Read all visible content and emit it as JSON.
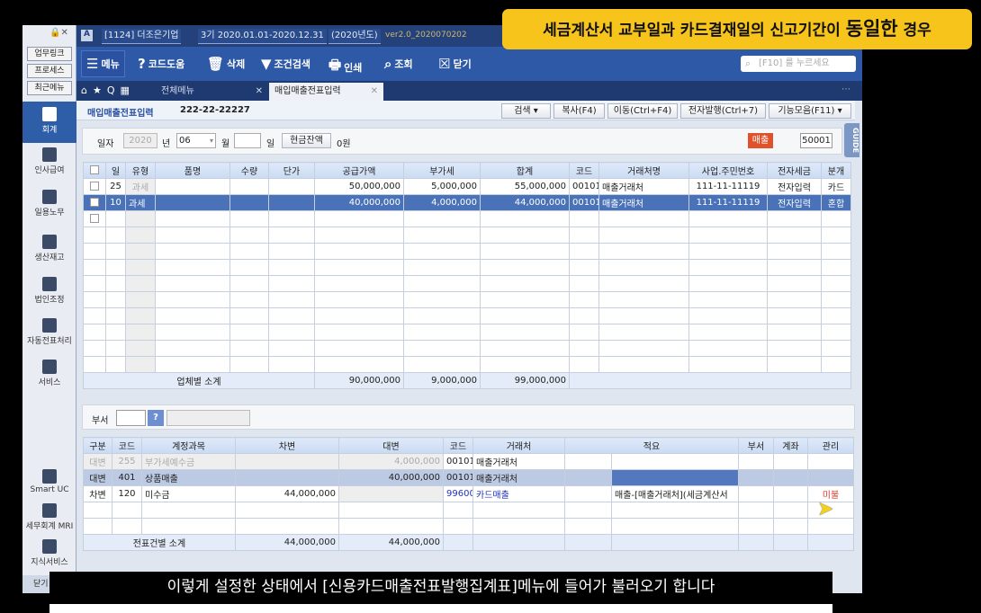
{
  "banner": {
    "pre": "세금계산서 교부일과 카드결재일의 신고기간이 ",
    "emph": "동일한",
    "post": " 경우"
  },
  "subtitle": "이렇게 설정한 상태에서 [신용카드매출전표발행집계표]메뉴에 들어가 불러오기 합니다",
  "titlebar": {
    "company": "[1124] 더조은기업",
    "period": "3기 2020.01.01-2020.12.31",
    "year": "(2020년도)",
    "version": "ver2.0_2020070202"
  },
  "sidebar": {
    "top_buttons": [
      "업무링크",
      "프로세스",
      "최근메뉴"
    ],
    "items": [
      "회계",
      "인사급여",
      "일용노무",
      "생산재고",
      "법인조정",
      "자동전표처리",
      "서비스"
    ],
    "bottom": [
      "Smart UC",
      "세무회계 MRI",
      "지식서비스"
    ],
    "close": "닫기"
  },
  "toolbar": [
    "메뉴",
    "코드도움",
    "삭제",
    "조건검색",
    "인쇄",
    "조회",
    "닫기"
  ],
  "search_placeholder": "[F10] 를 누르세요",
  "tabs": [
    "전체메뉴",
    "매입매출전표입력"
  ],
  "page": {
    "title": "매입매출전표입력",
    "bizno": "222-22-22227",
    "buttons": [
      "검색",
      "복사(F4)",
      "이동(Ctrl+F4)",
      "전자발행(Ctrl+7)",
      "기능모음(F11)"
    ],
    "guide": "GUIDE"
  },
  "filter": {
    "date_label": "일자",
    "year": "2020",
    "year_unit": "년",
    "month": "06",
    "month_unit": "월",
    "day": "",
    "day_unit": "일",
    "cash_button": "현금잔액",
    "cash_value": "0원",
    "type_badge": "매출",
    "code": "50001"
  },
  "upper_table": {
    "headers": [
      "",
      "일",
      "유형",
      "품명",
      "수량",
      "단가",
      "공급가액",
      "부가세",
      "합계",
      "코드",
      "거래처명",
      "사업.주민번호",
      "전자세금",
      "분개"
    ],
    "rows": [
      [
        "25",
        "과세",
        "",
        "",
        "",
        "50,000,000",
        "5,000,000",
        "55,000,000",
        "00101",
        "매출거래처",
        "111-11-11119",
        "전자입력",
        "카드"
      ],
      [
        "10",
        "과세",
        "",
        "",
        "",
        "40,000,000",
        "4,000,000",
        "44,000,000",
        "00101",
        "매출거래처",
        "111-11-11119",
        "전자입력",
        "혼합"
      ]
    ],
    "subtotal": {
      "label": "업체별 소계",
      "supply": "90,000,000",
      "vat": "9,000,000",
      "total": "99,000,000"
    }
  },
  "dept": {
    "label": "부서",
    "help": "?"
  },
  "lower_table": {
    "headers": [
      "구분",
      "코드",
      "계정과목",
      "차변",
      "대변",
      "코드",
      "거래처",
      "적요",
      "부서",
      "계좌",
      "관리"
    ],
    "rows": [
      [
        "대변",
        "255",
        "부가세예수금",
        "",
        "4,000,000",
        "00101",
        "매출거래처",
        "",
        "",
        "",
        ""
      ],
      [
        "대변",
        "401",
        "상품매출",
        "",
        "40,000,000",
        "00101",
        "매출거래처",
        "",
        "",
        "",
        ""
      ],
      [
        "차변",
        "120",
        "미수금",
        "44,000,000",
        "",
        "99600",
        "카드매출",
        "매출-[매출거래처](세금계산서",
        "",
        "",
        "미불"
      ]
    ],
    "subtotal": {
      "label": "전표건별 소계",
      "debit": "44,000,000",
      "credit": "44,000,000"
    }
  }
}
